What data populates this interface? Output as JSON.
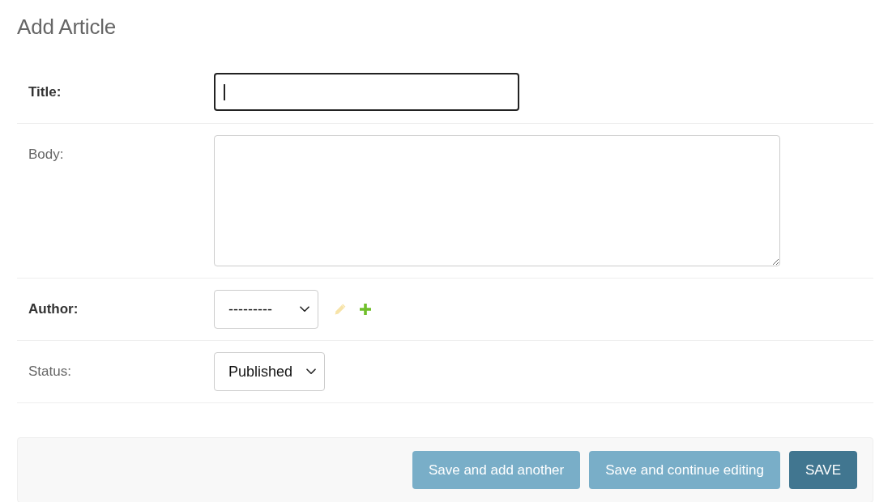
{
  "page": {
    "title": "Add Article"
  },
  "fields": [
    {
      "label": "Title:",
      "kind": "text",
      "required": true,
      "focused": true
    },
    {
      "label": "Body:",
      "kind": "textarea",
      "required": false,
      "focused": false
    },
    {
      "label": "Author:",
      "kind": "select",
      "required": true,
      "focused": false,
      "value": "---------",
      "actions": [
        {
          "kind": "edit",
          "disabled": true
        },
        {
          "kind": "add",
          "disabled": false
        }
      ]
    },
    {
      "label": "Status:",
      "kind": "select",
      "required": false,
      "focused": false,
      "value": "Published"
    }
  ],
  "buttons": [
    {
      "label": "Save and add another",
      "kind": "secondary"
    },
    {
      "label": "Save and continue editing",
      "kind": "secondary"
    },
    {
      "label": "SAVE",
      "kind": "default"
    }
  ]
}
